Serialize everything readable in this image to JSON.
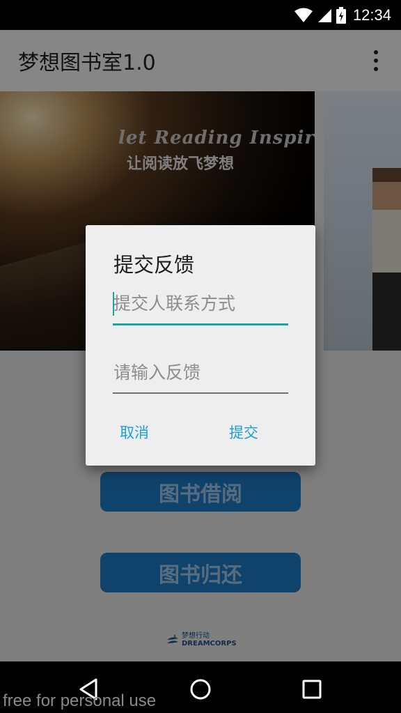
{
  "status_bar": {
    "time": "12:34"
  },
  "app_bar": {
    "title": "梦想图书室1.0"
  },
  "banner": {
    "slogan_en": "let Reading Inspire",
    "slogan_cn": "让阅读放飞梦想"
  },
  "buttons": {
    "borrow": "图书借阅",
    "return": "图书归还"
  },
  "footer": {
    "logo_cn": "梦想行动",
    "logo_en": "DREAMCORPS"
  },
  "dialog": {
    "title": "提交反馈",
    "contact_placeholder": "提交人联系方式",
    "feedback_placeholder": "请输入反馈",
    "cancel_label": "取消",
    "submit_label": "提交"
  },
  "watermark": "free for personal use",
  "colors": {
    "accent": "#1aa5a5",
    "dialog_button": "#1a9fd9",
    "primary_button": "#1d7ac4"
  }
}
